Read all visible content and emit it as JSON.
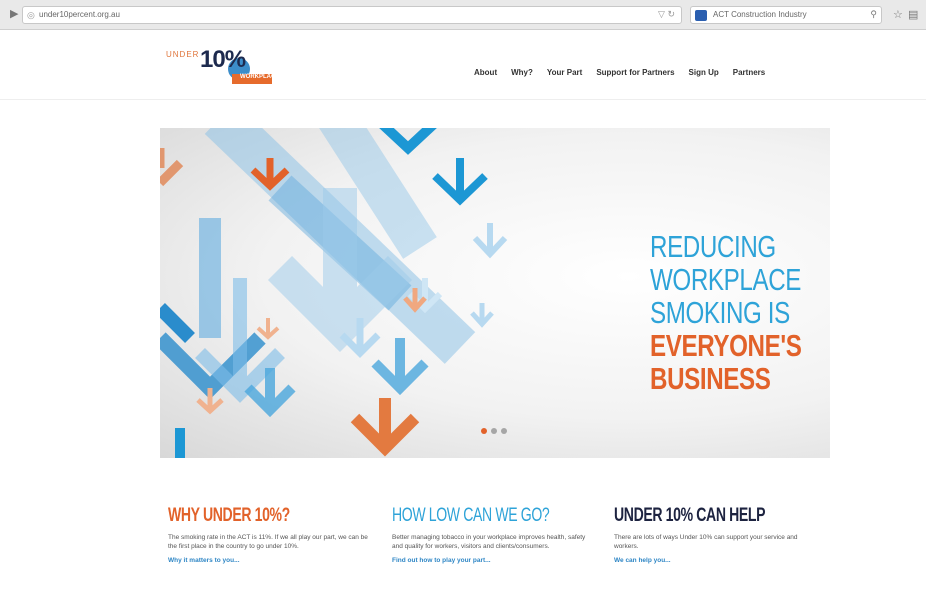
{
  "browser": {
    "url": "under10percent.org.au",
    "search_placeholder": "ACT Construction Industry"
  },
  "header": {
    "logo": {
      "prefix": "UNDER",
      "number": "10%",
      "subtitle": "WORKPLACE"
    },
    "nav": [
      {
        "label": "About"
      },
      {
        "label": "Why?"
      },
      {
        "label": "Your Part"
      },
      {
        "label": "Support for Partners"
      },
      {
        "label": "Sign Up"
      },
      {
        "label": "Partners"
      }
    ]
  },
  "hero": {
    "headline_lines": [
      "REDUCING",
      "WORKPLACE",
      "SMOKING IS",
      "EVERYONE'S",
      "BUSINESS"
    ],
    "colors": {
      "blue": "#2ea3d8",
      "orange": "#e2622a"
    },
    "slides": 3,
    "active_slide": 1
  },
  "columns": [
    {
      "heading": "WHY UNDER 10%?",
      "body": "The smoking rate in the ACT is 11%. If we all play our part, we can be the first place in the country to go under 10%.",
      "link": "Why it matters to you..."
    },
    {
      "heading": "HOW LOW CAN WE GO?",
      "body": "Better managing tobacco in your workplace improves health, safety and quality for workers, visitors and clients/consumers.",
      "link": "Find out how to play your part..."
    },
    {
      "heading": "UNDER 10% CAN HELP",
      "body": "There are lots of ways Under 10% can support your service and workers.",
      "link": "We can help you..."
    }
  ]
}
